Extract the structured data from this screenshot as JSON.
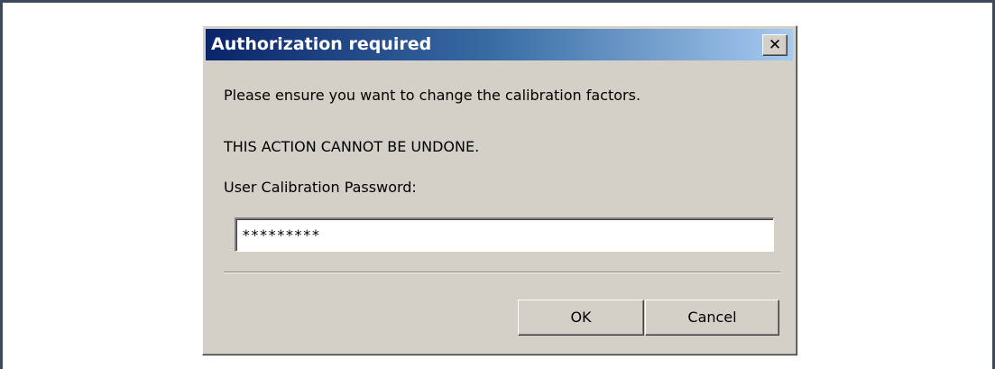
{
  "dialog": {
    "title": "Authorization required",
    "close_glyph": "✕",
    "close_icon": "close-icon",
    "message_line1": "Please ensure you want to change the calibration factors.",
    "message_line2": "THIS ACTION CANNOT BE UNDONE.",
    "password_label": "User Calibration Password:",
    "password_value": "*********",
    "ok_label": "OK",
    "cancel_label": "Cancel"
  },
  "colors": {
    "titlebar_start": "#0a246a",
    "titlebar_end": "#a6caf0",
    "dialog_bg": "#d4d0c8",
    "frame_border": "#3d4a5e"
  }
}
